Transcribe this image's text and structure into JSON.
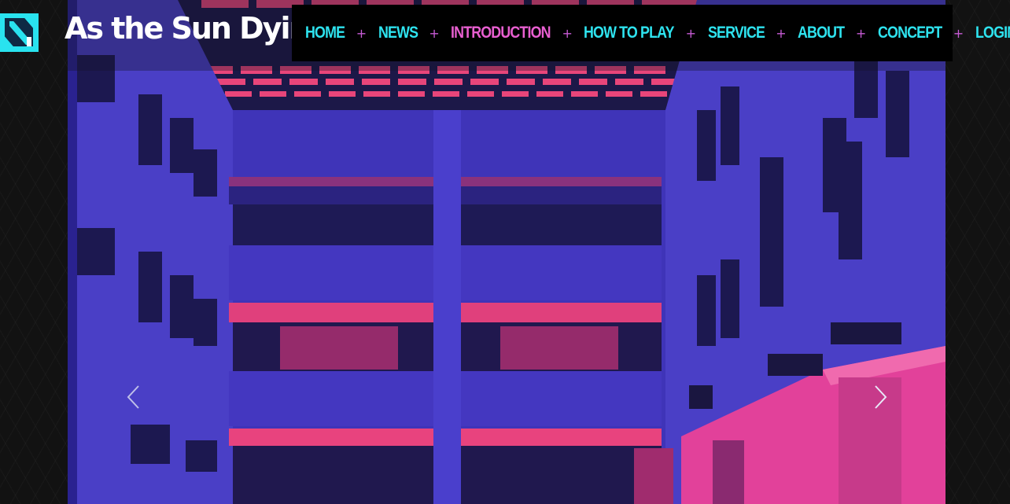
{
  "site": {
    "title": "As the Sun Dying",
    "logo_icon": "brand-logo-icon"
  },
  "nav": {
    "items": [
      {
        "label": "HOME",
        "active": false
      },
      {
        "label": "NEWS",
        "active": false
      },
      {
        "label": "INTRODUCTION",
        "active": true
      },
      {
        "label": "HOW TO PLAY",
        "active": false
      },
      {
        "label": "SERVICE",
        "active": false
      },
      {
        "label": "ABOUT",
        "active": false
      },
      {
        "label": "CONCEPT",
        "active": false
      },
      {
        "label": "LOGIN",
        "active": false
      }
    ],
    "separator": "+"
  },
  "carousel": {
    "prev_icon": "chevron-left-icon",
    "next_icon": "chevron-right-icon"
  },
  "colors": {
    "accent_cyan": "#2ee3ef",
    "accent_pink": "#e85fd0",
    "nav_bg": "#000000",
    "page_bg": "#121212"
  }
}
